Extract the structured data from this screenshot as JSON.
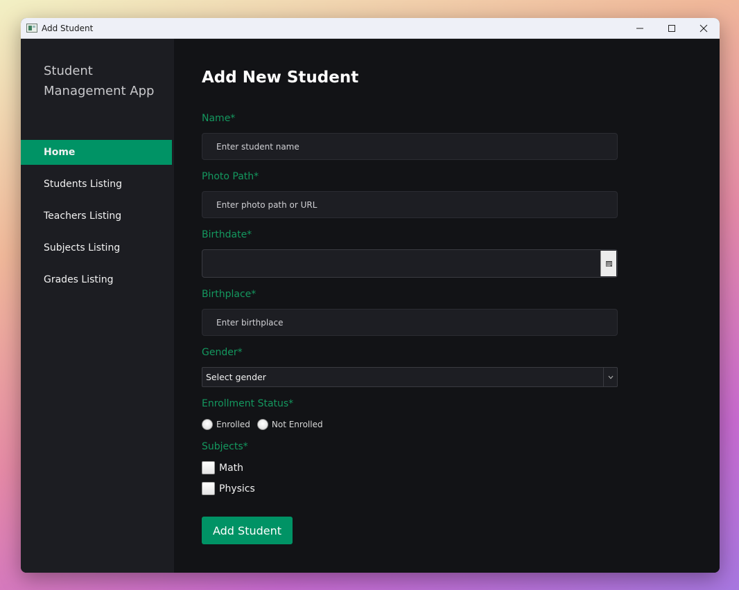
{
  "window": {
    "title": "Add Student"
  },
  "sidebar": {
    "app_title": "Student Management App",
    "items": [
      {
        "label": "Home",
        "active": true
      },
      {
        "label": "Students Listing",
        "active": false
      },
      {
        "label": "Teachers Listing",
        "active": false
      },
      {
        "label": "Subjects Listing",
        "active": false
      },
      {
        "label": "Grades Listing",
        "active": false
      }
    ]
  },
  "form": {
    "title": "Add New Student",
    "name": {
      "label": "Name*",
      "placeholder": "Enter student name",
      "value": ""
    },
    "photo": {
      "label": "Photo Path*",
      "placeholder": "Enter photo path or URL",
      "value": ""
    },
    "birthdate": {
      "label": "Birthdate*",
      "value": ""
    },
    "birthplace": {
      "label": "Birthplace*",
      "placeholder": "Enter birthplace",
      "value": ""
    },
    "gender": {
      "label": "Gender*",
      "selected": "Select gender"
    },
    "enrollment": {
      "label": "Enrollment Status*",
      "options": [
        "Enrolled",
        "Not Enrolled"
      ]
    },
    "subjects": {
      "label": "Subjects*",
      "options": [
        "Math",
        "Physics"
      ]
    },
    "submit_label": "Add Student"
  },
  "colors": {
    "accent": "#009365",
    "label_green": "#14985f",
    "sidebar_bg": "#1c1d22",
    "main_bg": "#121316"
  }
}
